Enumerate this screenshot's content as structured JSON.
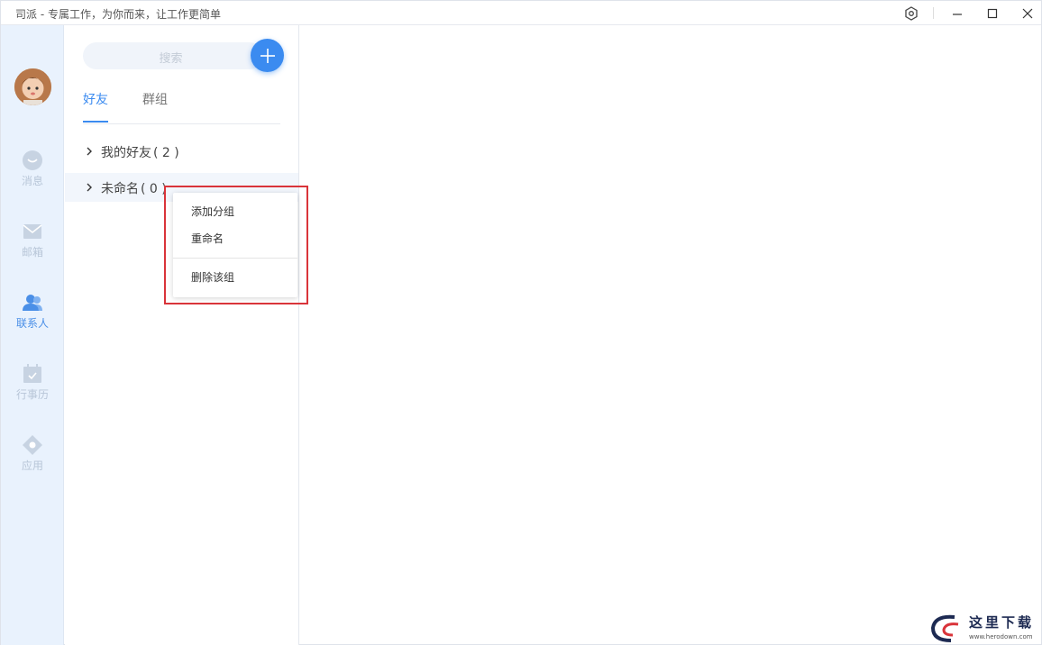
{
  "window": {
    "title": "司派 - 专属工作，为你而来，让工作更简单"
  },
  "rail": {
    "items": [
      {
        "label": "消息",
        "icon": "message-icon"
      },
      {
        "label": "邮箱",
        "icon": "mail-icon"
      },
      {
        "label": "联系人",
        "icon": "contacts-icon",
        "active": true
      },
      {
        "label": "行事历",
        "icon": "calendar-icon"
      },
      {
        "label": "应用",
        "icon": "apps-icon"
      }
    ]
  },
  "panel": {
    "search_placeholder": "搜索",
    "tabs": [
      {
        "label": "好友",
        "active": true
      },
      {
        "label": "群组"
      }
    ],
    "groups": [
      {
        "name": "我的好友",
        "count": "( 2 )"
      },
      {
        "name": "未命名",
        "count": "( 0 )"
      }
    ]
  },
  "context_menu": {
    "items": [
      "添加分组",
      "重命名",
      "删除该组"
    ]
  },
  "watermark": {
    "text": "这里下载",
    "url": "www.herodown.com"
  },
  "colors": {
    "accent": "#3b8bf0",
    "rail_bg": "#e9f2fd",
    "highlight": "#d9343a"
  }
}
